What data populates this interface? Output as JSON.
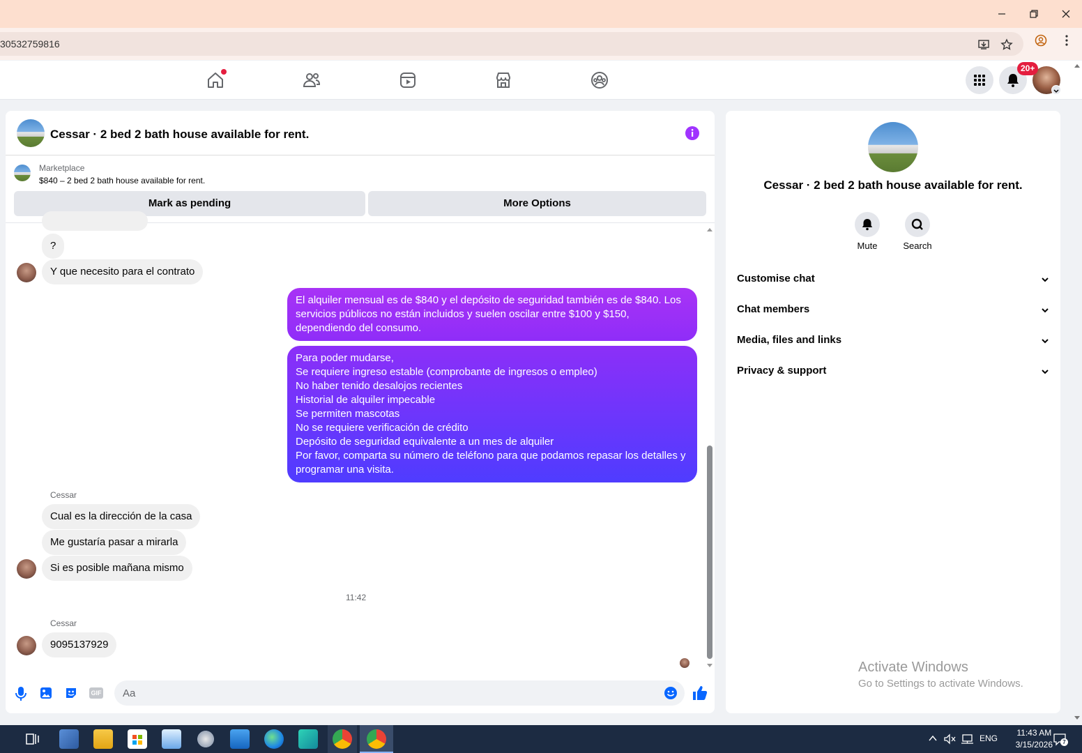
{
  "browser": {
    "url": "30532759816",
    "window_controls": [
      "minimize",
      "restore",
      "close"
    ]
  },
  "nav": {
    "notif_badge": "20+"
  },
  "chat": {
    "title": "Cessar · 2 bed 2 bath house available for rent.",
    "marketplace_label": "Marketplace",
    "listing": "$840 – 2 bed 2 bath house available for rent.",
    "mark_pending": "Mark as pending",
    "more_options": "More Options",
    "messages": {
      "q": "?",
      "contrato": "Y que necesito para el  contrato",
      "me1": "El alquiler mensual es de $840 y el depósito de seguridad también es de $840. Los servicios públicos no están incluidos y suelen oscilar entre $100 y $150, dependiendo del consumo.",
      "me2_lines": [
        "Para poder mudarse,",
        "Se requiere ingreso estable (comprobante de ingresos o empleo)",
        "No haber tenido desalojos recientes",
        "Historial de alquiler impecable",
        "Se permiten mascotas",
        "No se requiere verificación de crédito",
        "Depósito de seguridad equivalente a un mes de alquiler",
        "Por favor, comparta su número de teléfono para que podamos repasar los detalles y programar una visita."
      ],
      "sender": "Cessar",
      "direccion": "Cual es la dirección de la casa",
      "mirarla": "Me gustaría pasar a mirarla",
      "manana": "Si es posible mañana mismo",
      "time": "11:42",
      "phone": "9095137929"
    },
    "composer_placeholder": "Aa",
    "gif_label": "GIF",
    "gradient_start": "#a033ff",
    "gradient_end": "#4b3bff"
  },
  "info": {
    "title": "Cessar · 2 bed 2 bath house available for rent.",
    "mute": "Mute",
    "search": "Search",
    "sections": [
      "Customise chat",
      "Chat members",
      "Media, files and links",
      "Privacy & support"
    ]
  },
  "watermark": {
    "line1": "Activate Windows",
    "line2": "Go to Settings to activate Windows."
  },
  "taskbar": {
    "lang": "ENG",
    "time": "11:43 AM",
    "date": "3/15/2026",
    "notif_count": "7"
  }
}
